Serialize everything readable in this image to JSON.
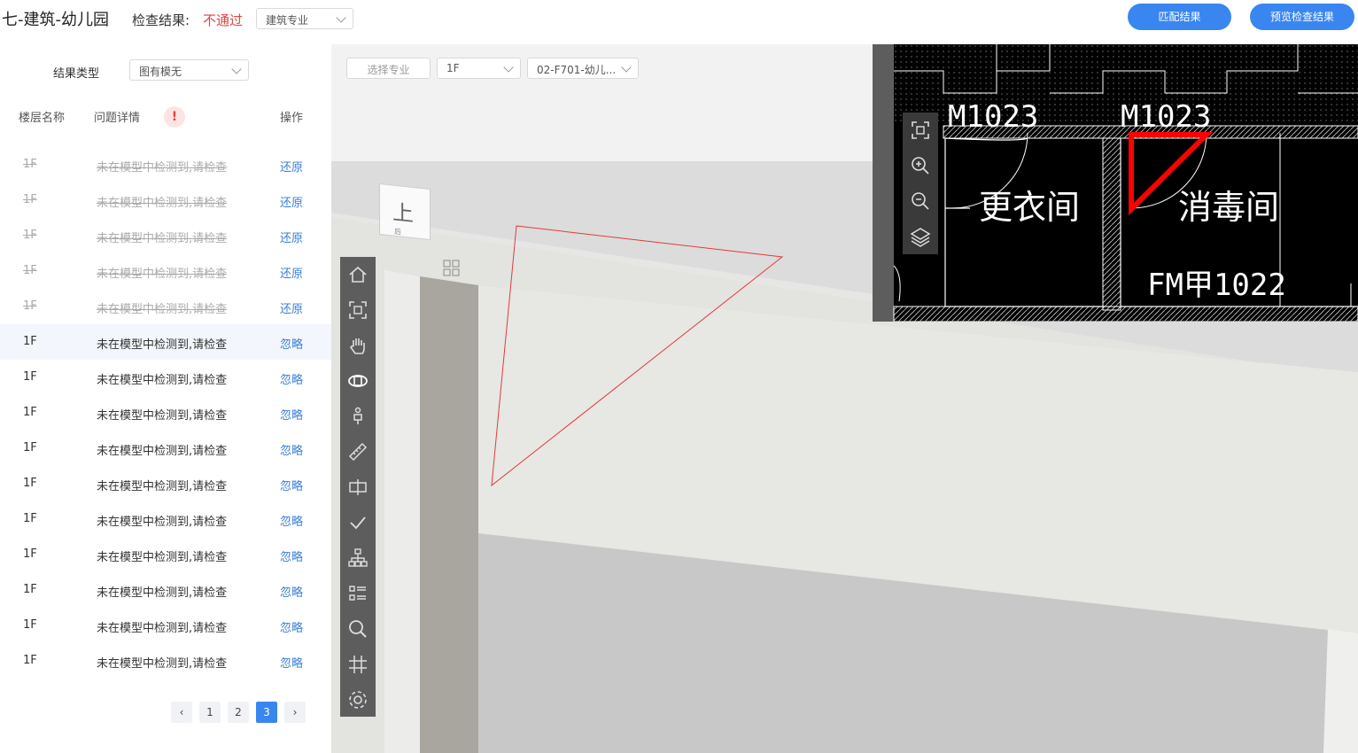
{
  "header": {
    "title": "七-建筑-幼儿园",
    "result_label": "检查结果:",
    "result_value": "不通过",
    "discipline_select": "建筑专业",
    "match_button": "匹配结果",
    "preview_button": "预览检查结果"
  },
  "filter": {
    "label": "结果类型",
    "value": "图有模无"
  },
  "table": {
    "headers": [
      "楼层名称",
      "问题详情",
      "操作"
    ],
    "warn_icon": "!",
    "rows": [
      {
        "floor": "1F",
        "detail": "未在模型中检测到,请检查",
        "action": "还原",
        "struck": true
      },
      {
        "floor": "1F",
        "detail": "未在模型中检测到,请检查",
        "action": "还原",
        "struck": true
      },
      {
        "floor": "1F",
        "detail": "未在模型中检测到,请检查",
        "action": "还原",
        "struck": true
      },
      {
        "floor": "1F",
        "detail": "未在模型中检测到,请检查",
        "action": "还原",
        "struck": true
      },
      {
        "floor": "1F",
        "detail": "未在模型中检测到,请检查",
        "action": "还原",
        "struck": true
      },
      {
        "floor": "1F",
        "detail": "未在模型中检测到,请检查",
        "action": "忽略",
        "struck": false
      },
      {
        "floor": "1F",
        "detail": "未在模型中检测到,请检查",
        "action": "忽略",
        "struck": false
      },
      {
        "floor": "1F",
        "detail": "未在模型中检测到,请检查",
        "action": "忽略",
        "struck": false
      },
      {
        "floor": "1F",
        "detail": "未在模型中检测到,请检查",
        "action": "忽略",
        "struck": false
      },
      {
        "floor": "1F",
        "detail": "未在模型中检测到,请检查",
        "action": "忽略",
        "struck": false
      },
      {
        "floor": "1F",
        "detail": "未在模型中检测到,请检查",
        "action": "忽略",
        "struck": false
      },
      {
        "floor": "1F",
        "detail": "未在模型中检测到,请检查",
        "action": "忽略",
        "struck": false
      },
      {
        "floor": "1F",
        "detail": "未在模型中检测到,请检查",
        "action": "忽略",
        "struck": false
      },
      {
        "floor": "1F",
        "detail": "未在模型中检测到,请检查",
        "action": "忽略",
        "struck": false
      },
      {
        "floor": "1F",
        "detail": "未在模型中检测到,请检查",
        "action": "忽略",
        "struck": false
      }
    ]
  },
  "pagination": {
    "pages": [
      "1",
      "2",
      "3"
    ],
    "current": "3",
    "prev": "‹",
    "next": "›"
  },
  "viewport": {
    "select_discipline": "选择专业",
    "select_floor": "1F",
    "select_drawing": "02-F701-幼儿...",
    "navcube_face": "上",
    "navcube_small": "后",
    "tools": [
      "home-icon",
      "fit-view-icon",
      "pan-hand-icon",
      "orbit-icon",
      "person-walk-icon",
      "measure-ruler-icon",
      "section-icon",
      "check-icon",
      "structure-tree-icon",
      "list-icon",
      "search-icon",
      "grid-axis-icon",
      "settings-icon"
    ]
  },
  "cad": {
    "labels": [
      "M1023",
      "M1023",
      "更衣间",
      "消毒间",
      "FM甲1022"
    ],
    "tools": [
      "fit-view-icon",
      "zoom-in-icon",
      "zoom-out-icon",
      "layers-icon"
    ],
    "accent_color": "#ff0000"
  },
  "colors": {
    "primary": "#3a86f0",
    "danger": "#e04343",
    "link": "#3a7fd8"
  }
}
